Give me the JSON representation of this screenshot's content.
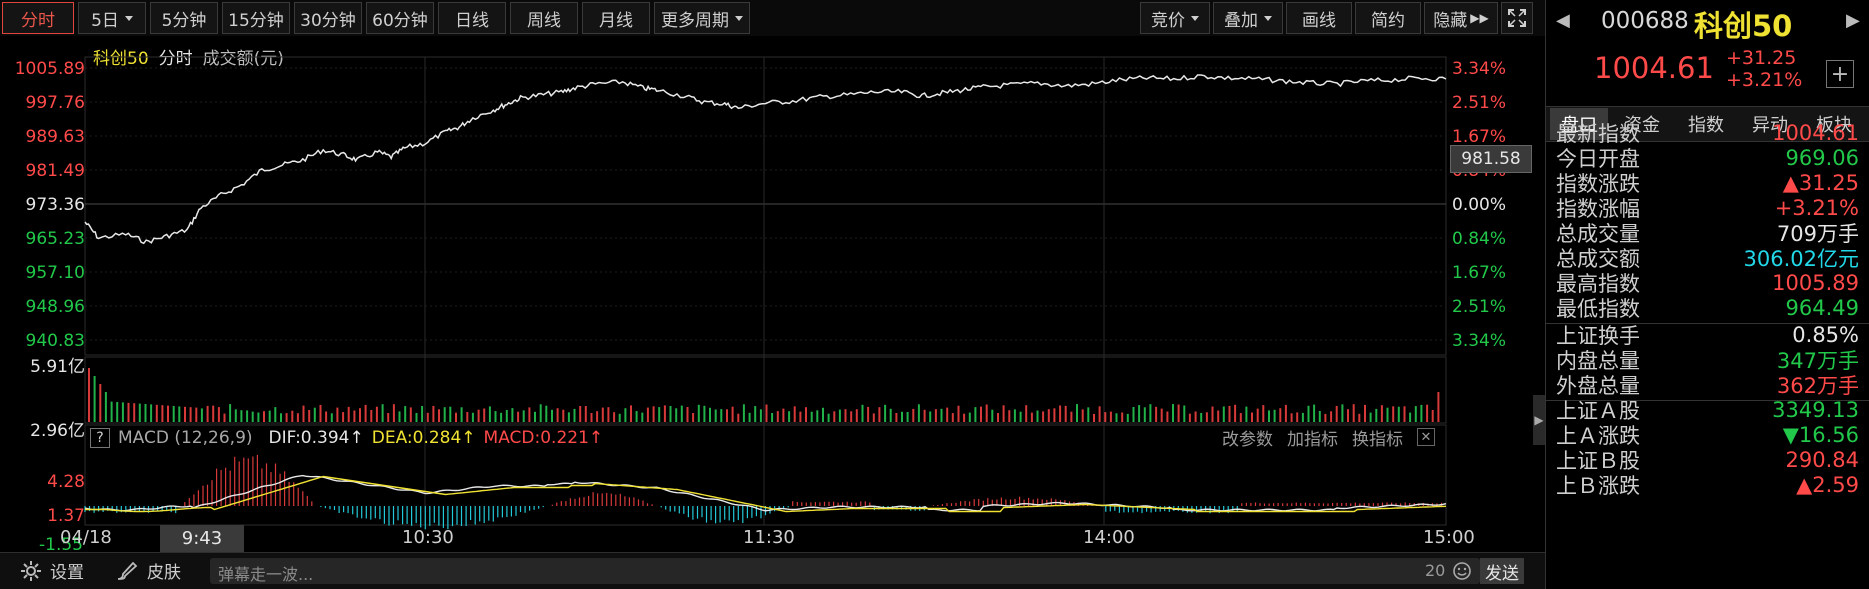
{
  "toolbar": {
    "periods": [
      "分时",
      "5日",
      "5分钟",
      "15分钟",
      "30分钟",
      "60分钟",
      "日线",
      "周线",
      "月线",
      "更多周期"
    ],
    "right_buttons": [
      "竞价",
      "叠加",
      "画线",
      "简约",
      "隐藏"
    ]
  },
  "chart_header": {
    "name": "科创50",
    "mode": "分时",
    "volume_label": "成交额(元)"
  },
  "price_axis": {
    "left": [
      "1005.89",
      "997.76",
      "989.63",
      "981.49",
      "973.36",
      "965.23",
      "957.10",
      "948.96",
      "940.83"
    ],
    "right": [
      "3.34%",
      "2.51%",
      "1.67%",
      "0.84%",
      "0.00%",
      "0.84%",
      "1.67%",
      "2.51%",
      "3.34%"
    ],
    "crosshair_value": "981.58"
  },
  "volume_axis": [
    "5.91亿",
    "2.96亿"
  ],
  "macd": {
    "help": "?",
    "title": "MACD (12,26,9)",
    "dif": "DIF:0.394",
    "dea": "DEA:0.284",
    "macd": "MACD:0.221",
    "axis": [
      "4.28",
      "1.37",
      "-1.55"
    ],
    "buttons": [
      "改参数",
      "加指标",
      "换指标"
    ]
  },
  "time_axis": {
    "labels": [
      "04/18",
      "10:30",
      "11:30",
      "14:00",
      "15:00"
    ],
    "cursor_time": "9:43"
  },
  "statusbar": {
    "settings": "设置",
    "skin": "皮肤",
    "danmaku_placeholder": "弹幕走一波...",
    "char_count": "20",
    "send": "发送"
  },
  "quote": {
    "code": "000688",
    "name": "科创50",
    "price": "1004.61",
    "change": "+31.25",
    "change_pct": "+3.21%",
    "tabs": [
      "盘口",
      "资金",
      "指数",
      "异动",
      "板块"
    ],
    "rows": [
      {
        "label": "最新指数",
        "value": "1004.61",
        "color": "#ff4a4a"
      },
      {
        "label": "今日开盘",
        "value": "969.06",
        "color": "#22c84a"
      },
      {
        "label": "指数涨跌",
        "value": "▲31.25",
        "color": "#ff4a4a"
      },
      {
        "label": "指数涨幅",
        "value": "+3.21%",
        "color": "#ff4a4a"
      },
      {
        "label": "总成交量",
        "value": "709万手",
        "color": "#e6e6e6"
      },
      {
        "label": "总成交额",
        "value": "306.02亿元",
        "color": "#22d8e8"
      },
      {
        "label": "最高指数",
        "value": "1005.89",
        "color": "#ff4a4a"
      },
      {
        "label": "最低指数",
        "value": "964.49",
        "color": "#22c84a"
      },
      {
        "label": "上证换手",
        "value": "0.85%",
        "color": "#e6e6e6"
      },
      {
        "label": "内盘总量",
        "value": "347万手",
        "color": "#22c84a"
      },
      {
        "label": "外盘总量",
        "value": "362万手",
        "color": "#ff4a4a"
      },
      {
        "label": "上证Ａ股",
        "value": "3349.13",
        "color": "#22c84a"
      },
      {
        "label": "上Ａ涨跌",
        "value": "▼16.56",
        "color": "#22c84a"
      },
      {
        "label": "上证Ｂ股",
        "value": "290.84",
        "color": "#ff4a4a"
      },
      {
        "label": "上Ｂ涨跌",
        "value": "▲2.59",
        "color": "#ff4a4a"
      }
    ]
  },
  "colors": {
    "up": "#ff4a4a",
    "down": "#22c84a",
    "price_line": "#e8e8e8",
    "dea_line": "#f0e233",
    "accent": "#e0473c"
  }
}
